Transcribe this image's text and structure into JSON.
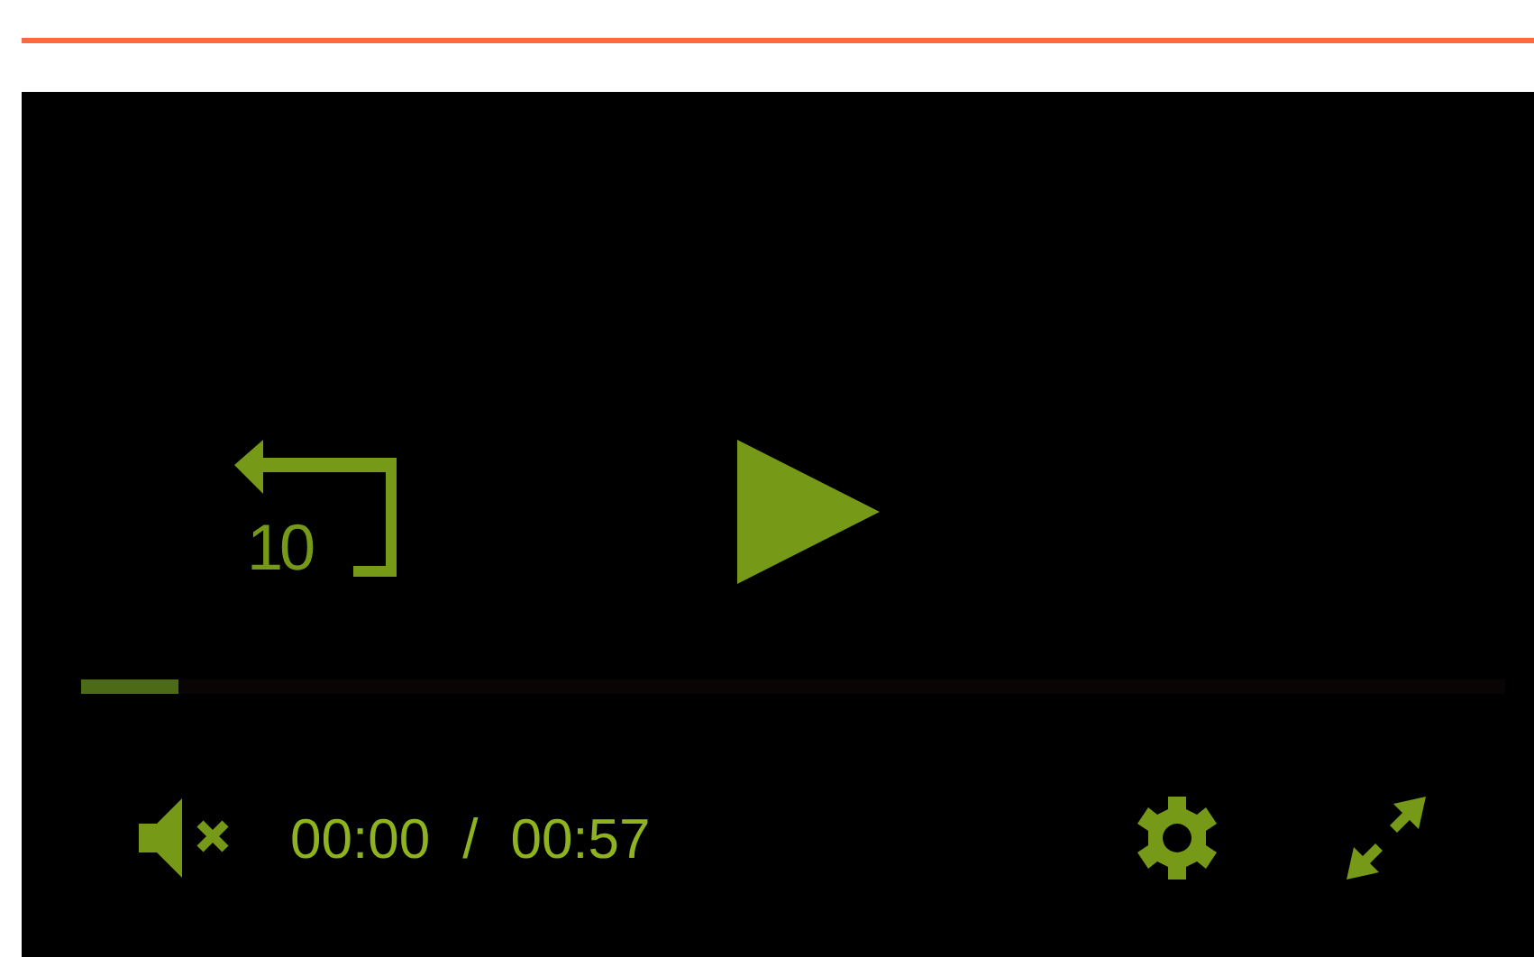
{
  "player": {
    "playing": false,
    "muted": true,
    "skip_label": "10",
    "progress": {
      "level": 0.068
    },
    "current_time": "00:00",
    "separator": "/",
    "duration": "00:57"
  }
}
